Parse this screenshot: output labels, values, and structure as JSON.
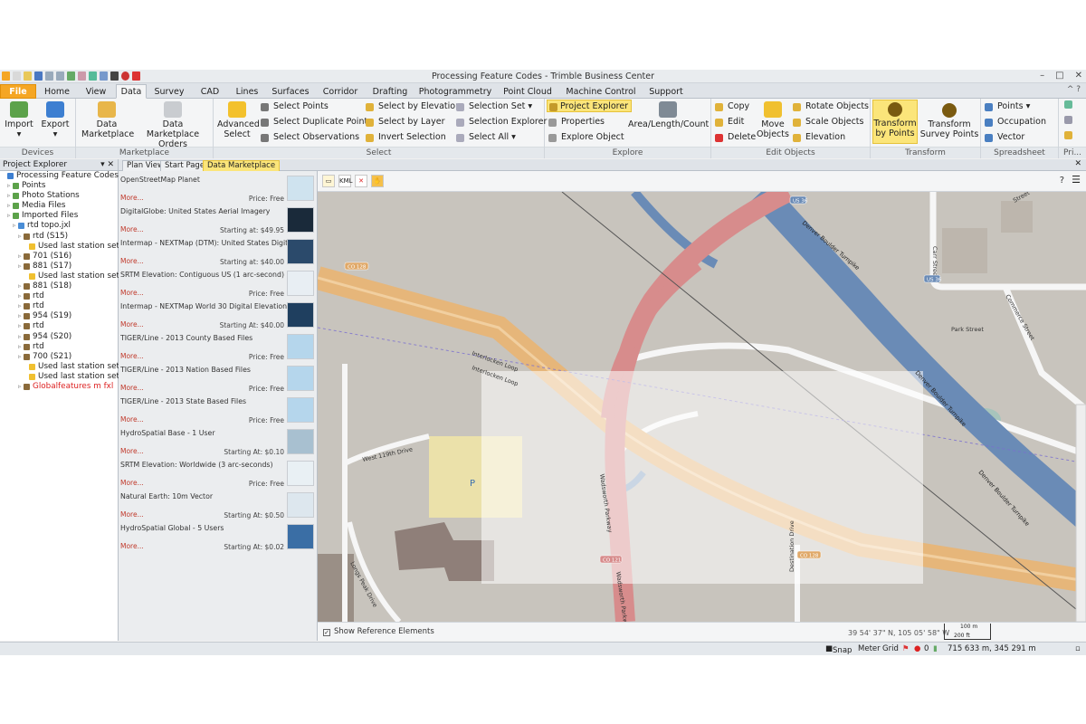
{
  "window": {
    "title": "Processing Feature Codes - Trimble Business Center"
  },
  "tabs": [
    "File",
    "Home",
    "View",
    "Data",
    "Survey",
    "CAD",
    "Lines",
    "Surfaces",
    "Corridor",
    "Drafting",
    "Photogrammetry",
    "Point Cloud",
    "Machine Control",
    "Support"
  ],
  "active_tab": "Data",
  "tab_right": "^  ?",
  "ribbon": {
    "devices": {
      "label": "Devices",
      "import": "Import",
      "export": "Export"
    },
    "marketplace": {
      "label": "Marketplace",
      "data_marketplace_1": "Data",
      "data_marketplace_2": "Marketplace",
      "orders_1": "Data Marketplace",
      "orders_2": "Orders"
    },
    "select": {
      "label": "Select",
      "advanced_1": "Advanced",
      "advanced_2": "Select",
      "select_points": "Select Points",
      "select_duplicate_points": "Select Duplicate Points",
      "select_observations": "Select Observations",
      "select_by_elevation": "Select by Elevation",
      "select_by_layer": "Select by Layer",
      "invert_selection": "Invert Selection",
      "selection_set": "Selection Set",
      "selection_explorer": "Selection Explorer",
      "select_all": "Select All"
    },
    "explore": {
      "label": "Explore",
      "project_explorer": "Project Explorer",
      "properties": "Properties",
      "explore_object": "Explore Object",
      "area_length_count": "Area/Length/Count"
    },
    "edit_objects": {
      "label": "Edit Objects",
      "copy": "Copy",
      "edit": "Edit",
      "delete": "Delete",
      "move_1": "Move",
      "move_2": "Objects",
      "rotate": "Rotate Objects",
      "scale": "Scale Objects",
      "elevation": "Elevation"
    },
    "transform": {
      "label": "Transform",
      "by_points_1": "Transform",
      "by_points_2": "by Points",
      "survey_points_1": "Transform",
      "survey_points_2": "Survey Points"
    },
    "spreadsheet": {
      "label": "Spreadsheet",
      "points": "Points",
      "occupation": "Occupation",
      "vector": "Vector"
    },
    "pri": {
      "label": "Pri..."
    }
  },
  "project_explorer": {
    "title": "Project Explorer",
    "nodes": [
      {
        "label": "Processing Feature Codes",
        "indent": 0
      },
      {
        "label": "Points",
        "indent": 1
      },
      {
        "label": "Photo Stations",
        "indent": 1
      },
      {
        "label": "Media Files",
        "indent": 1
      },
      {
        "label": "Imported Files",
        "indent": 1
      },
      {
        "label": "rtd topo.jxl",
        "indent": 2
      },
      {
        "label": "rtd (S15)",
        "indent": 3
      },
      {
        "label": "Used last station setup",
        "indent": 4
      },
      {
        "label": "701 (S16)",
        "indent": 3
      },
      {
        "label": "881 (S17)",
        "indent": 3
      },
      {
        "label": "Used last station setup",
        "indent": 4
      },
      {
        "label": "881 (S18)",
        "indent": 3
      },
      {
        "label": "rtd",
        "indent": 3
      },
      {
        "label": "rtd",
        "indent": 3
      },
      {
        "label": "954 (S19)",
        "indent": 3
      },
      {
        "label": "rtd",
        "indent": 3
      },
      {
        "label": "954 (S20)",
        "indent": 3
      },
      {
        "label": "rtd",
        "indent": 3
      },
      {
        "label": "700 (S21)",
        "indent": 3
      },
      {
        "label": "Used last station setup",
        "indent": 4
      },
      {
        "label": "Used last station setup",
        "indent": 4
      },
      {
        "label": "Globalfeatures m fxl",
        "indent": 3
      }
    ]
  },
  "doc_tabs": [
    "Plan View",
    "Start Page",
    "Data Marketplace"
  ],
  "active_doc_tab": "Data Marketplace",
  "toolbar": {
    "help": "?",
    "menu": "☰",
    "kml": "KML"
  },
  "marketplace_items": [
    {
      "name": "OpenStreetMap Planet",
      "more": "More...",
      "price": "Price: Free"
    },
    {
      "name": "DigitalGlobe: United States Aerial Imagery",
      "more": "More...",
      "price": "Starting at: $49.95"
    },
    {
      "name": "Intermap - NEXTMap (DTM): United States Digital",
      "more": "More...",
      "price": "Starting at: $40.00"
    },
    {
      "name": "SRTM Elevation: Contiguous US (1 arc-second)",
      "more": "More...",
      "price": "Price: Free"
    },
    {
      "name": "Intermap - NEXTMap World 30 Digital Elevation",
      "more": "More...",
      "price": "Starting At: $40.00"
    },
    {
      "name": "TIGER/Line - 2013 County Based Files",
      "more": "More...",
      "price": "Price: Free"
    },
    {
      "name": "TIGER/Line - 2013 Nation Based Files",
      "more": "More...",
      "price": "Price: Free"
    },
    {
      "name": "TIGER/Line - 2013 State Based Files",
      "more": "More...",
      "price": "Price: Free"
    },
    {
      "name": "HydroSpatial Base - 1 User",
      "more": "More...",
      "price": "Starting At: $0.10"
    },
    {
      "name": "SRTM Elevation: Worldwide (3 arc-seconds)",
      "more": "More...",
      "price": "Price: Free"
    },
    {
      "name": "Natural Earth: 10m Vector",
      "more": "More...",
      "price": "Starting At: $0.50"
    },
    {
      "name": "HydroSpatial Global - 5 Users",
      "more": "More...",
      "price": "Starting At: $0.02"
    }
  ],
  "map": {
    "labels": {
      "interlocken1": "Interlocken Loop",
      "interlocken2": "Interlocken Loop",
      "west119": "West 119th Drive",
      "wadsworth1": "Wadsworth Parkway",
      "wadsworth2": "Wadsworth Parkway",
      "denver1": "Denver Boulder Turnpike",
      "denver2": "Denver Boulder Turnpike",
      "denver3": "Denver Boulder Turnpike",
      "park": "Park Street",
      "carr": "Carr Street",
      "commerce": "Commerce Street",
      "street": "Street",
      "destination": "Destination Drive",
      "longs": "Longs Peak Drive",
      "parking": "P",
      "us36a": "US 36",
      "us36b": "US 36",
      "co128a": "CO 128",
      "co128b": "CO 128",
      "co121": "CO 121"
    },
    "coords": "39 54' 37\" N, 105 05' 58\" W",
    "scale_top": "100 m",
    "scale_bottom": "200 ft",
    "show_ref": "Show Reference Elements"
  },
  "status": {
    "snap": "Snap",
    "meter": "Meter",
    "grid": "Grid",
    "count": "0",
    "coords": "715 633 m, 345 291 m"
  }
}
